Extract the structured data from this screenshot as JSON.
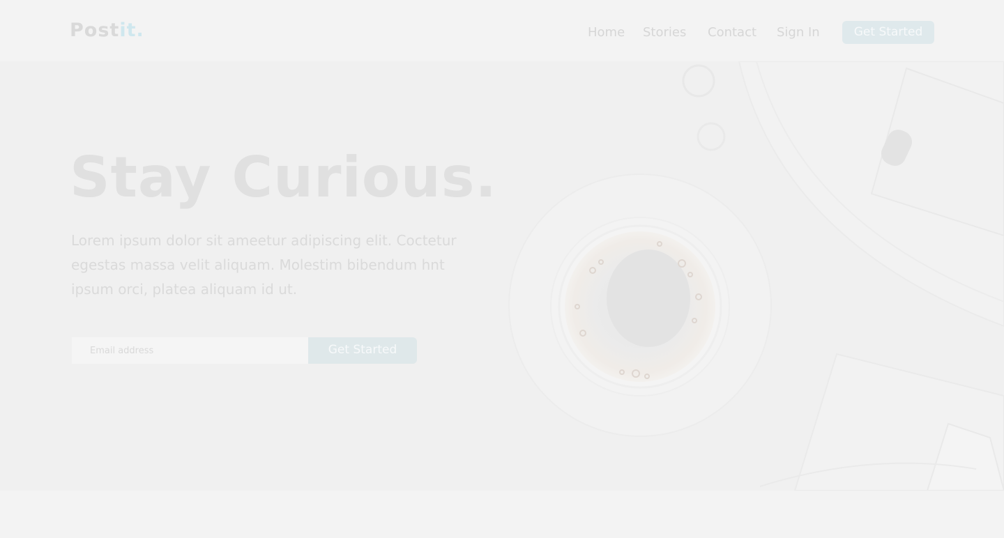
{
  "header": {
    "logo_main": "Post",
    "logo_accent": "it",
    "logo_dot": ".",
    "nav": {
      "home": "Home",
      "stories": "Stories",
      "contact": "Contact",
      "sign_in": "Sign In",
      "get_started": "Get Started"
    }
  },
  "hero": {
    "title": "Stay Curious.",
    "description": "Lorem ipsum dolor sit ameetur adipiscing elit. Coctetur egestas massa velit aliquam. Molestim bibendum hnt ipsum orci, platea aliquam id ut.",
    "email_placeholder": "Email address",
    "email_value": "",
    "cta_label": "Get Started",
    "image_subject": "coffee-cup-desk-photo"
  },
  "colors": {
    "accent": "#cfe7ee",
    "button_bg": "#dfe9ec"
  }
}
